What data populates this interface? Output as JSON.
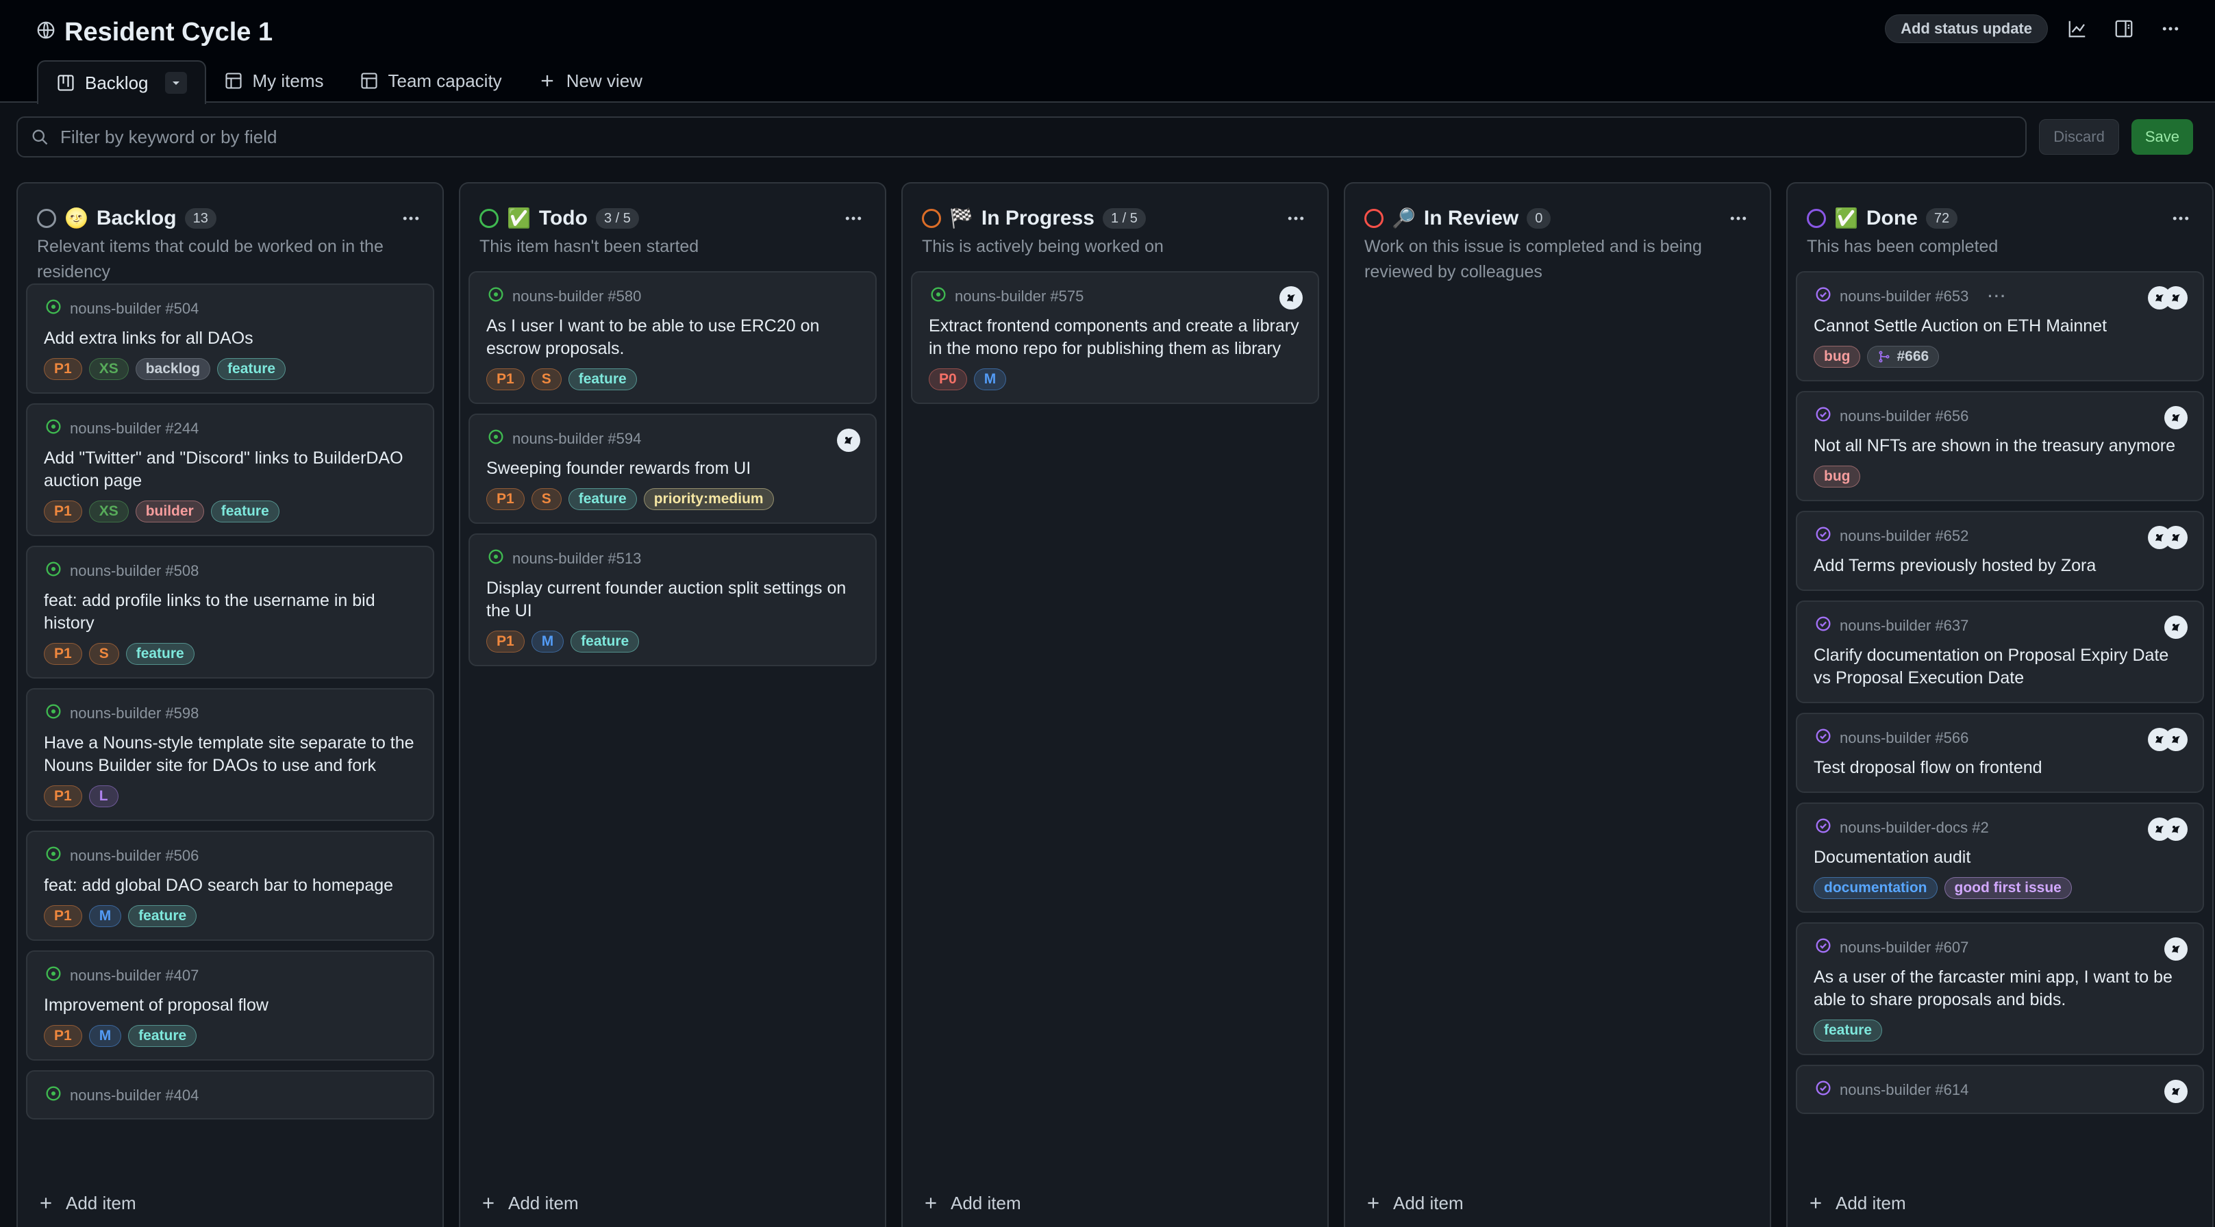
{
  "header": {
    "title": "Resident Cycle 1",
    "status_button": "Add status update"
  },
  "tabs": [
    {
      "label": "Backlog"
    },
    {
      "label": "My items"
    },
    {
      "label": "Team capacity"
    },
    {
      "label": "New view"
    }
  ],
  "filter": {
    "placeholder": "Filter by keyword or by field",
    "discard": "Discard",
    "save": "Save"
  },
  "colors": {
    "p1": "#f0883e",
    "p0": "#f47067",
    "xs": "#57ab5a",
    "s": "#f0883e",
    "m": "#539bf5",
    "l": "#b083f0",
    "feature": "#7ee8dc",
    "bug": "#f69d9d",
    "backlog": "#c9d1d9",
    "builder": "#f69d9d",
    "documentation": "#58a6ff",
    "good_first_issue": "#d2a8ff",
    "priority_medium": "#f5e6a3"
  },
  "add_item_label": "Add item",
  "columns": [
    {
      "name": "Backlog",
      "count": "13",
      "emoji": "🌝",
      "desc": "Relevant items that could be worked on in the residency",
      "cards": [
        {
          "meta": "nouns-builder #504",
          "title": "Add extra links for all DAOs",
          "labels": [
            "P1",
            "XS",
            "backlog",
            "feature"
          ]
        },
        {
          "meta": "nouns-builder #244",
          "title": "Add \"Twitter\" and \"Discord\" links to BuilderDAO auction page",
          "labels": [
            "P1",
            "XS",
            "builder",
            "feature"
          ]
        },
        {
          "meta": "nouns-builder #508",
          "title": "feat: add profile links to the username in bid history",
          "labels": [
            "P1",
            "S",
            "feature"
          ]
        },
        {
          "meta": "nouns-builder #598",
          "title": "Have a Nouns-style template site separate to the Nouns Builder site for DAOs to use and fork",
          "labels": [
            "P1",
            "L"
          ]
        },
        {
          "meta": "nouns-builder #506",
          "title": "feat: add global DAO search bar to homepage",
          "labels": [
            "P1",
            "M",
            "feature"
          ]
        },
        {
          "meta": "nouns-builder #407",
          "title": "Improvement of proposal flow",
          "labels": [
            "P1",
            "M",
            "feature"
          ]
        },
        {
          "meta": "nouns-builder #404",
          "title": "",
          "labels": []
        }
      ]
    },
    {
      "name": "Todo",
      "count": "3 / 5",
      "emoji": "✅",
      "desc": "This item hasn't been started",
      "cards": [
        {
          "meta": "nouns-builder #580",
          "title": "As I user I want to be able to use ERC20 on escrow proposals.",
          "labels": [
            "P1",
            "S",
            "feature"
          ]
        },
        {
          "meta": "nouns-builder #594",
          "title": "Sweeping founder rewards from UI",
          "labels": [
            "P1",
            "S",
            "feature",
            "priority:medium"
          ]
        },
        {
          "meta": "nouns-builder #513",
          "title": "Display current founder auction split settings on the UI",
          "labels": [
            "P1",
            "M",
            "feature"
          ]
        }
      ]
    },
    {
      "name": "In Progress",
      "count": "1 / 5",
      "emoji": "🏁",
      "desc": "This is actively being worked on",
      "cards": [
        {
          "meta": "nouns-builder #575",
          "title": "Extract frontend components and create a library in the mono repo for publishing them as library",
          "labels": [
            "P0",
            "M"
          ]
        }
      ]
    },
    {
      "name": "In Review",
      "count": "0",
      "emoji": "🔎",
      "desc": "Work on this issue is completed and is being reviewed by colleagues",
      "cards": []
    },
    {
      "name": "Done",
      "count": "72",
      "emoji": "✅",
      "desc": "This has been completed",
      "cards": [
        {
          "meta": "nouns-builder #653",
          "title": "Cannot Settle Auction on ETH Mainnet",
          "labels": [
            "bug"
          ],
          "pr": "#666"
        },
        {
          "meta": "nouns-builder #656",
          "title": "Not all NFTs are shown in the treasury anymore",
          "labels": [
            "bug"
          ]
        },
        {
          "meta": "nouns-builder #652",
          "title": "Add Terms previously hosted by Zora",
          "labels": []
        },
        {
          "meta": "nouns-builder #637",
          "title": "Clarify documentation on Proposal Expiry Date vs Proposal Execution Date",
          "labels": []
        },
        {
          "meta": "nouns-builder #566",
          "title": "Test droposal flow on frontend",
          "labels": []
        },
        {
          "meta": "nouns-builder-docs #2",
          "title": "Documentation audit",
          "labels": [
            "documentation",
            "good first issue"
          ]
        },
        {
          "meta": "nouns-builder #607",
          "title": "As a user of the farcaster mini app, I want to be able to share proposals and bids.",
          "labels": [
            "feature"
          ]
        },
        {
          "meta": "nouns-builder #614",
          "title": "",
          "labels": []
        }
      ]
    }
  ]
}
